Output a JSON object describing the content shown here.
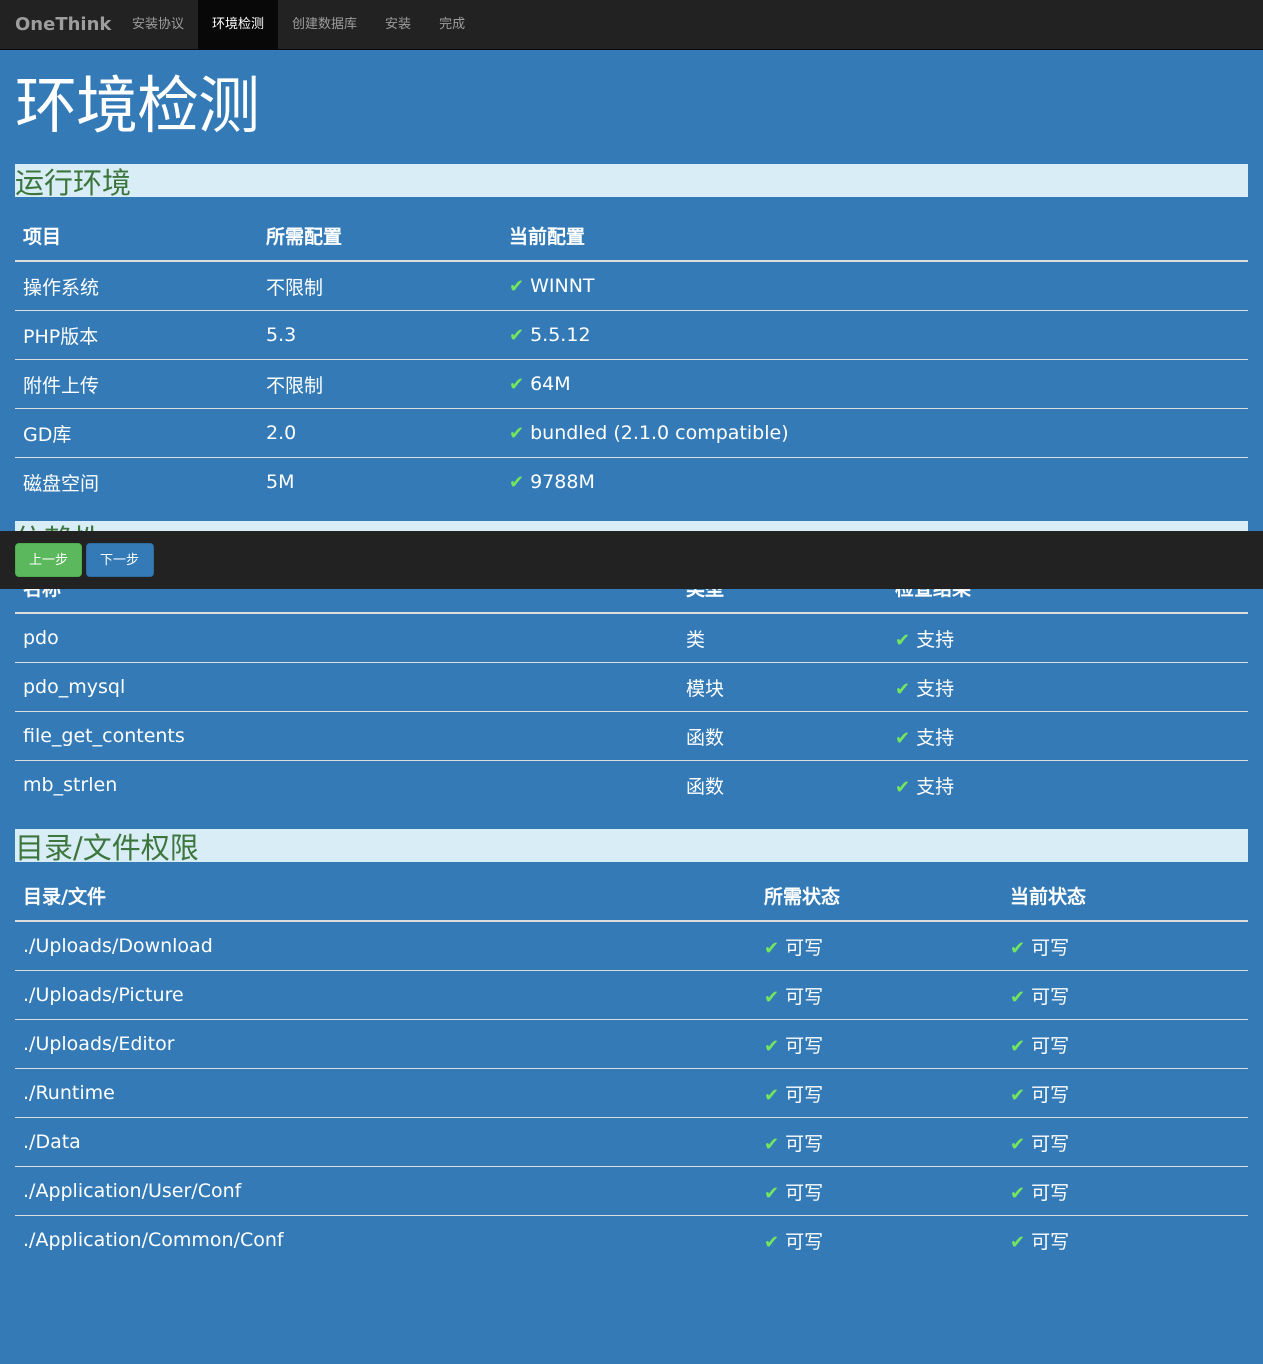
{
  "navbar": {
    "brand": "OneThink",
    "items": [
      {
        "label": "安装协议",
        "active": false
      },
      {
        "label": "环境检测",
        "active": true
      },
      {
        "label": "创建数据库",
        "active": false
      },
      {
        "label": "安装",
        "active": false
      },
      {
        "label": "完成",
        "active": false
      }
    ]
  },
  "page_title": "环境检测",
  "ok_icon": "checkmark-icon",
  "colors": {
    "background": "#337ab7",
    "section_bg": "#d9edf7",
    "section_text": "#3c763d",
    "ok": "#73e65d",
    "navbar": "#222222",
    "prev_button": "#5cb85c"
  },
  "env": {
    "title": "运行环境",
    "headers": [
      "项目",
      "所需配置",
      "当前配置"
    ],
    "rows": [
      {
        "name": "操作系统",
        "required": "不限制",
        "current": "WINNT"
      },
      {
        "name": "PHP版本",
        "required": "5.3",
        "current": "5.5.12"
      },
      {
        "name": "附件上传",
        "required": "不限制",
        "current": "64M"
      },
      {
        "name": "GD库",
        "required": "2.0",
        "current": "bundled (2.1.0 compatible)"
      },
      {
        "name": "磁盘空间",
        "required": "5M",
        "current": "9788M"
      }
    ]
  },
  "deps": {
    "title": "依赖性",
    "headers": [
      "名称",
      "类型",
      "检查结果"
    ],
    "rows": [
      {
        "name": "pdo",
        "type": "类",
        "result": "支持"
      },
      {
        "name": "pdo_mysql",
        "type": "模块",
        "result": "支持"
      },
      {
        "name": "file_get_contents",
        "type": "函数",
        "result": "支持"
      },
      {
        "name": "mb_strlen",
        "type": "函数",
        "result": "支持"
      }
    ]
  },
  "dirs": {
    "title": "目录/文件权限",
    "headers": [
      "目录/文件",
      "所需状态",
      "当前状态"
    ],
    "rows": [
      {
        "path": "./Uploads/Download",
        "required": "可写",
        "current": "可写"
      },
      {
        "path": "./Uploads/Picture",
        "required": "可写",
        "current": "可写"
      },
      {
        "path": "./Uploads/Editor",
        "required": "可写",
        "current": "可写"
      },
      {
        "path": "./Runtime",
        "required": "可写",
        "current": "可写"
      },
      {
        "path": "./Data",
        "required": "可写",
        "current": "可写"
      },
      {
        "path": "./Application/User/Conf",
        "required": "可写",
        "current": "可写"
      },
      {
        "path": "./Application/Common/Conf",
        "required": "可写",
        "current": "可写"
      }
    ]
  },
  "actions": {
    "prev": "上一步",
    "next": "下一步"
  }
}
